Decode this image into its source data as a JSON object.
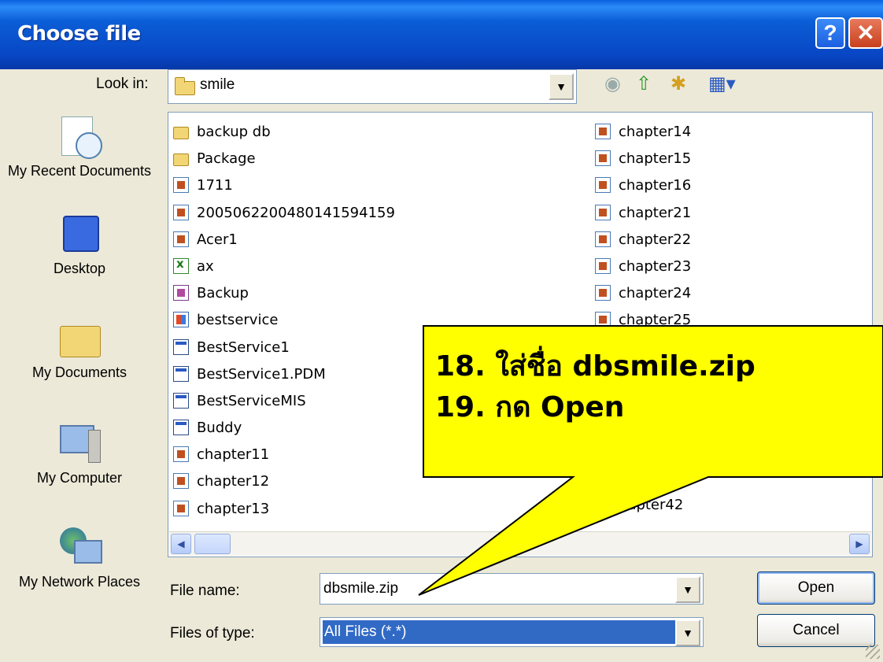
{
  "window": {
    "title": "Choose file"
  },
  "lookin": {
    "label": "Look in:",
    "value": "smile"
  },
  "places": [
    {
      "label": "My Recent Documents",
      "icon": "recent-documents-icon"
    },
    {
      "label": "Desktop",
      "icon": "desktop-icon"
    },
    {
      "label": "My Documents",
      "icon": "my-documents-icon"
    },
    {
      "label": "My Computer",
      "icon": "my-computer-icon"
    },
    {
      "label": "My Network Places",
      "icon": "network-places-icon"
    }
  ],
  "files_col1": [
    {
      "name": "backup db",
      "type": "folder"
    },
    {
      "name": "Package",
      "type": "folder"
    },
    {
      "name": "1711",
      "type": "zip"
    },
    {
      "name": "20050622004801415941​59",
      "type": "zip"
    },
    {
      "name": "Acer1",
      "type": "zip"
    },
    {
      "name": "ax",
      "type": "xls"
    },
    {
      "name": "Backup",
      "type": "doc"
    },
    {
      "name": "bestservice",
      "type": "app"
    },
    {
      "name": "BestService1",
      "type": "vb"
    },
    {
      "name": "BestService1.PDM",
      "type": "vb"
    },
    {
      "name": "BestServiceMIS",
      "type": "vb"
    },
    {
      "name": "Buddy",
      "type": "vb"
    },
    {
      "name": "chapter11",
      "type": "zip"
    },
    {
      "name": "chapter12",
      "type": "zip"
    },
    {
      "name": "chapter13",
      "type": "zip"
    }
  ],
  "files_col2": [
    {
      "name": "chapter14",
      "type": "zip"
    },
    {
      "name": "chapter15",
      "type": "zip"
    },
    {
      "name": "chapter16",
      "type": "zip"
    },
    {
      "name": "chapter21",
      "type": "zip"
    },
    {
      "name": "chapter22",
      "type": "zip"
    },
    {
      "name": "chapter23",
      "type": "zip"
    },
    {
      "name": "chapter24",
      "type": "zip"
    },
    {
      "name": "chapter25",
      "type": "zip"
    }
  ],
  "partial_file": "hapter42",
  "filename": {
    "label": "File name:",
    "value": "dbsmile.zip"
  },
  "filetype": {
    "label": "Files of type:",
    "value": "All Files (*.*)"
  },
  "buttons": {
    "open": "Open",
    "cancel": "Cancel"
  },
  "callout": {
    "line1": "18. ใส่ชื่อ dbsmile.zip",
    "line2": "19. กด Open"
  }
}
